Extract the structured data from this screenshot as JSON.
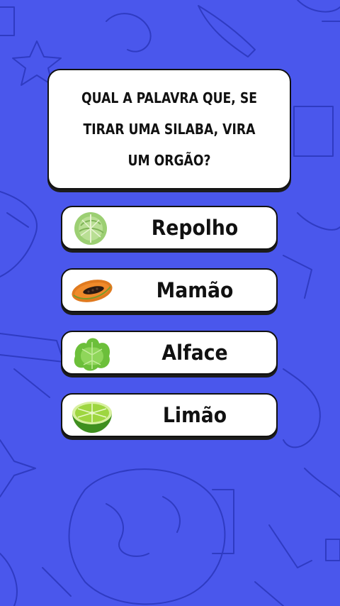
{
  "quiz": {
    "question": "QUAL A PALAVRA QUE, SE TIRAR UMA SILABA, VIRA UM ORGÃO?",
    "options": [
      {
        "label": "Repolho",
        "icon": "cabbage-icon"
      },
      {
        "label": "Mamão",
        "icon": "papaya-icon"
      },
      {
        "label": "Alface",
        "icon": "lettuce-icon"
      },
      {
        "label": "Limão",
        "icon": "lime-icon"
      }
    ]
  },
  "colors": {
    "background": "#4a57ec",
    "card": "#ffffff",
    "border": "#111111"
  }
}
